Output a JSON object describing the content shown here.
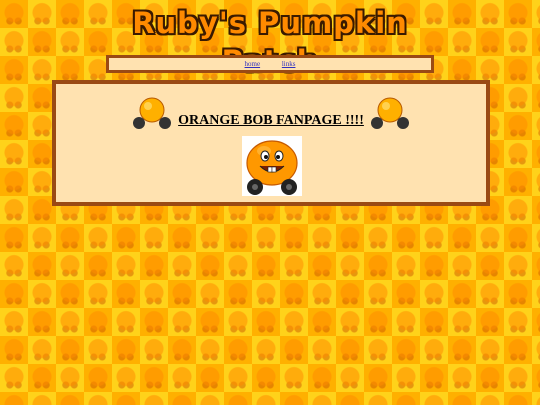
{
  "site": {
    "logo_text": "Ruby's Pumpkin Patch"
  },
  "nav": {
    "links": [
      "home",
      "links"
    ]
  },
  "main": {
    "title": "ORANGE BOB FANPAGE !!!!"
  },
  "colors": {
    "background_orange": "#ffb000",
    "background_yellow": "#ffd21a",
    "panel_bg": "#ffe2b0",
    "panel_border": "#9a4a14",
    "logo_fill": "#ff8a00"
  },
  "icons": {
    "side_image": "pumpkin-car-icon",
    "center_image": "orange-bob-face-icon"
  }
}
